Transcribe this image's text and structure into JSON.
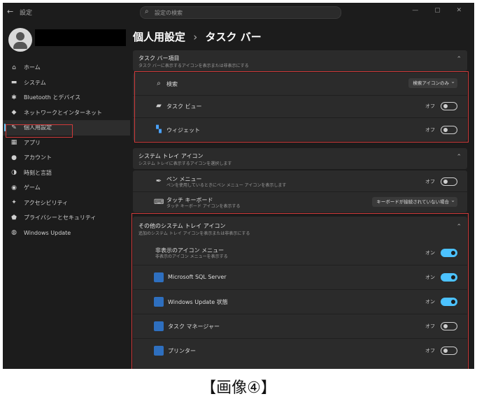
{
  "window": {
    "back_glyph": "←",
    "title": "設定",
    "search_placeholder": "設定の検索",
    "controls": "— ▢ ✕"
  },
  "sidebar": {
    "items": [
      {
        "icon": "home-icon",
        "glyph": "⌂",
        "label": "ホーム"
      },
      {
        "icon": "system-icon",
        "glyph": "▬",
        "label": "システム"
      },
      {
        "icon": "bluetooth-icon",
        "glyph": "✱",
        "label": "Bluetooth とデバイス"
      },
      {
        "icon": "network-icon",
        "glyph": "◆",
        "label": "ネットワークとインターネット"
      },
      {
        "icon": "personalization-icon",
        "glyph": "✎",
        "label": "個人用設定"
      },
      {
        "icon": "apps-icon",
        "glyph": "▦",
        "label": "アプリ"
      },
      {
        "icon": "accounts-icon",
        "glyph": "●",
        "label": "アカウント"
      },
      {
        "icon": "time-language-icon",
        "glyph": "◑",
        "label": "時刻と言語"
      },
      {
        "icon": "gaming-icon",
        "glyph": "◉",
        "label": "ゲーム"
      },
      {
        "icon": "accessibility-icon",
        "glyph": "✦",
        "label": "アクセシビリティ"
      },
      {
        "icon": "privacy-icon",
        "glyph": "⬟",
        "label": "プライバシーとセキュリティ"
      },
      {
        "icon": "update-icon",
        "glyph": "◍",
        "label": "Windows Update"
      }
    ],
    "active_index": 4
  },
  "header": {
    "breadcrumb_parent": "個人用設定",
    "separator": "›",
    "current": "タスク バー"
  },
  "sections": {
    "taskbar_items": {
      "title": "タスク バー項目",
      "subtitle": "タスク バーに表示するアイコンを表示または非表示にする",
      "rows": [
        {
          "icon": "search-icon",
          "glyph": "⌕",
          "label": "検索",
          "dropdown": "検索アイコンのみ"
        },
        {
          "icon": "taskview-icon",
          "glyph": "▰",
          "label": "タスク ビュー",
          "state": "オフ",
          "on": false
        },
        {
          "icon": "widgets-icon",
          "glyph": "▚",
          "label": "ウィジェット",
          "state": "オフ",
          "on": false
        }
      ]
    },
    "tray_icons": {
      "title": "システム トレイ アイコン",
      "subtitle": "システム トレイに表示するアイコンを選択します",
      "rows": [
        {
          "icon": "pen-icon",
          "glyph": "✒",
          "label": "ペン メニュー",
          "sub": "ペンを使用しているときにペン メニュー アイコンを表示します",
          "state": "オフ",
          "on": false
        },
        {
          "icon": "keyboard-icon",
          "glyph": "⌨",
          "label": "タッチ キーボード",
          "sub": "タッチ キーボード アイコンを表示する",
          "dropdown": "キーボードが接続されていない場合"
        }
      ]
    },
    "other_tray": {
      "title": "その他のシステム トレイ アイコン",
      "subtitle": "追加のシステム トレイ アイコンを表示または非表示にする",
      "rows": [
        {
          "label": "非表示のアイコン メニュー",
          "sub": "非表示のアイコン メニューを表示する",
          "state": "オン",
          "on": true,
          "app": false
        },
        {
          "label": "Microsoft SQL Server",
          "state": "オン",
          "on": true,
          "app": true
        },
        {
          "label": "Windows Update 状態",
          "state": "オン",
          "on": true,
          "app": true
        },
        {
          "label": "タスク マネージャー",
          "state": "オフ",
          "on": false,
          "app": true
        },
        {
          "label": "プリンター",
          "state": "オフ",
          "on": false,
          "app": true
        }
      ]
    }
  },
  "caption": "【画像④】"
}
